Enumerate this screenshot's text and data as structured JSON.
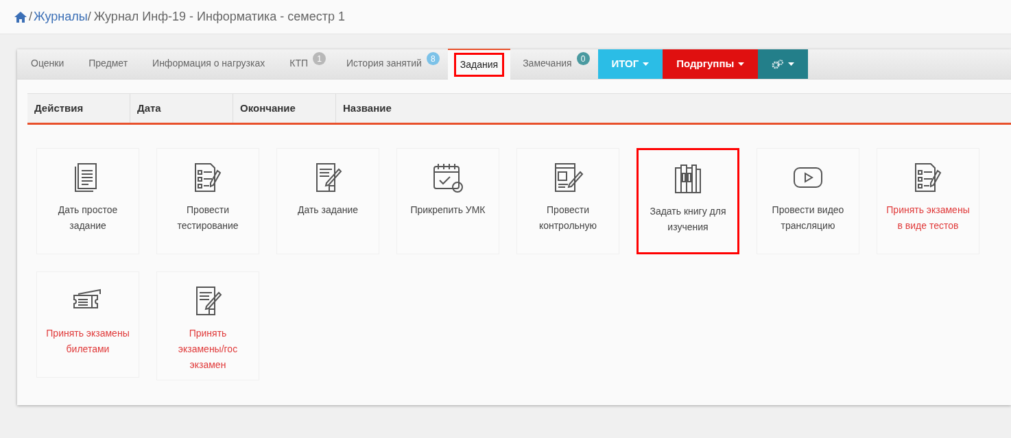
{
  "breadcrumb": {
    "separator": "/",
    "links": [
      "Журналы"
    ],
    "current": "Журнал Инф-19 - Информатика - семестр 1"
  },
  "tabs": [
    {
      "label": "Оценки",
      "selected": false,
      "highlighted": false
    },
    {
      "label": "Предмет",
      "selected": false,
      "highlighted": false
    },
    {
      "label": "Информация о нагрузках",
      "selected": false,
      "highlighted": false
    },
    {
      "label": "КТП",
      "selected": false,
      "highlighted": false,
      "badge": {
        "text": "1",
        "color": "#b8b8b8"
      }
    },
    {
      "label": "История занятий",
      "selected": false,
      "highlighted": false,
      "badge": {
        "text": "8",
        "color": "#7cc2e8"
      }
    },
    {
      "label": "Задания",
      "selected": true,
      "highlighted": true
    },
    {
      "label": "Замечания",
      "selected": false,
      "highlighted": false,
      "badge": {
        "text": "0",
        "color": "#4a9aa0"
      }
    }
  ],
  "dropdowns": [
    {
      "label": "ИТОГ",
      "color": "#2bbde6"
    },
    {
      "label": "Подргуппы",
      "color": "#e01010"
    },
    {
      "color": "#237f8a"
    }
  ],
  "table": {
    "columns": [
      "Действия",
      "Дата",
      "Окончание",
      "Название"
    ]
  },
  "cards": [
    {
      "label": "Дать простое задание",
      "exam": false,
      "highlighted": false
    },
    {
      "label": "Провести тестирование",
      "exam": false,
      "highlighted": false
    },
    {
      "label": "Дать задание",
      "exam": false,
      "highlighted": false
    },
    {
      "label": "Прикрепить УМК",
      "exam": false,
      "highlighted": false
    },
    {
      "label": "Провести контрольную",
      "exam": false,
      "highlighted": false
    },
    {
      "label": "Задать книгу для изучения",
      "exam": false,
      "highlighted": true
    },
    {
      "label": "Провести видео трансляцию",
      "exam": false,
      "highlighted": false
    },
    {
      "label": "Принять экзамены в виде тестов",
      "exam": true,
      "highlighted": false
    },
    {
      "label": "Принять экзамены билетами",
      "exam": true,
      "highlighted": false
    },
    {
      "label": "Принять экзамены/гос экзамен",
      "exam": true,
      "highlighted": false
    }
  ]
}
